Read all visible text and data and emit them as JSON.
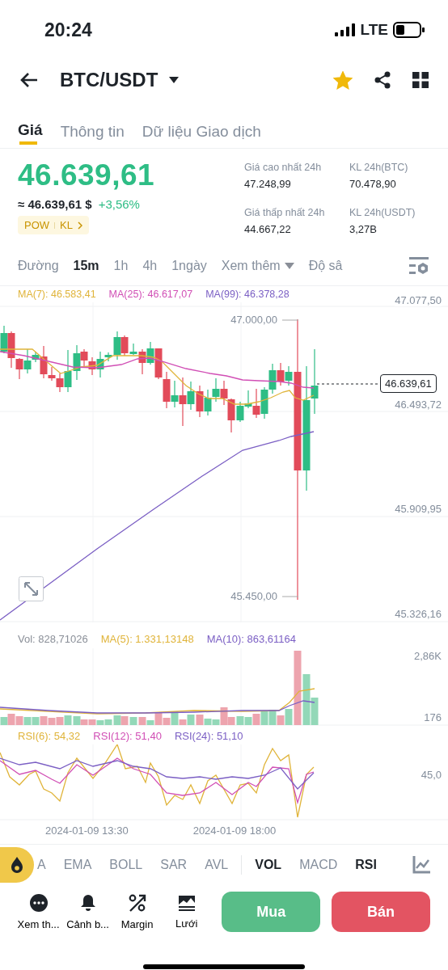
{
  "status_bar": {
    "time": "20:24",
    "network": "LTE"
  },
  "header": {
    "pair": "BTC/USDT",
    "favorite": true
  },
  "tabs": [
    {
      "label": "Giá",
      "selected": true
    },
    {
      "label": "Thông tin",
      "selected": false
    },
    {
      "label": "Dữ liệu Giao dịch",
      "selected": false
    }
  ],
  "price": {
    "last": "46.639,61",
    "fiat": "≈ 46.639,61 $",
    "change": "+3,56%",
    "tags": [
      "POW",
      "KL"
    ]
  },
  "stats": [
    {
      "label": "Giá cao nhất 24h",
      "value": "47.248,99"
    },
    {
      "label": "KL 24h(BTC)",
      "value": "70.478,90"
    },
    {
      "label": "Giá thấp nhất 24h",
      "value": "44.667,22"
    },
    {
      "label": "KL 24h(USDT)",
      "value": "3,27B"
    }
  ],
  "intervals": [
    {
      "label": "Đường",
      "selected": false,
      "kind": "plain"
    },
    {
      "label": "15m",
      "selected": true,
      "kind": "plain"
    },
    {
      "label": "1h",
      "selected": false,
      "kind": "plain"
    },
    {
      "label": "4h",
      "selected": false,
      "kind": "plain"
    },
    {
      "label": "1ngày",
      "selected": false,
      "kind": "plain"
    },
    {
      "label": "Xem thêm",
      "selected": false,
      "kind": "dropdown"
    },
    {
      "label": "Độ sâ",
      "selected": false,
      "kind": "plain"
    }
  ],
  "chart": {
    "legend": [
      {
        "label": "MA(7): 46.583,41",
        "color": "#e0b43a"
      },
      {
        "label": "MA(25): 46.617,07",
        "color": "#d14fb5"
      },
      {
        "label": "MA(99): 46.378,28",
        "color": "#7b5fc4"
      }
    ],
    "price_axis": [
      "47.077,50",
      "46.493,72",
      "45.909,95",
      "45.326,16"
    ],
    "high_marker": "47.000,00",
    "low_marker": "45.450,00",
    "last_price": "46.639,61"
  },
  "volume": {
    "legend": [
      {
        "label": "Vol: 828,71026",
        "color": "#8a8f98"
      },
      {
        "label": "MA(5): 1.331,13148",
        "color": "#e0b43a"
      },
      {
        "label": "MA(10): 863,61164",
        "color": "#7b5fc4"
      }
    ],
    "axis": [
      "2,86K",
      "176"
    ]
  },
  "rsi": {
    "legend": [
      {
        "label": "RSI(6): 54,32",
        "color": "#e0b43a"
      },
      {
        "label": "RSI(12): 51,40",
        "color": "#d14fb5"
      },
      {
        "label": "RSI(24): 51,10",
        "color": "#7b5fc4"
      }
    ],
    "axis": [
      "45,0"
    ]
  },
  "time_axis": [
    "2024-01-09 13:30",
    "2024-01-09 18:00"
  ],
  "main_indicators": [
    {
      "label": "A",
      "selected": false
    },
    {
      "label": "EMA",
      "selected": false
    },
    {
      "label": "BOLL",
      "selected": false
    },
    {
      "label": "SAR",
      "selected": false
    },
    {
      "label": "AVL",
      "selected": false
    }
  ],
  "sub_indicators": [
    {
      "label": "VOL",
      "selected": true
    },
    {
      "label": "MACD",
      "selected": false
    },
    {
      "label": "RSI",
      "selected": true
    }
  ],
  "actions": [
    {
      "label": "Xem th...",
      "kind": "more"
    },
    {
      "label": "Cảnh b...",
      "kind": "alert"
    },
    {
      "label": "Margin",
      "kind": "margin"
    },
    {
      "label": "Lưới",
      "kind": "grid"
    }
  ],
  "trade_buttons": {
    "buy": "Mua",
    "sell": "Bán"
  }
}
